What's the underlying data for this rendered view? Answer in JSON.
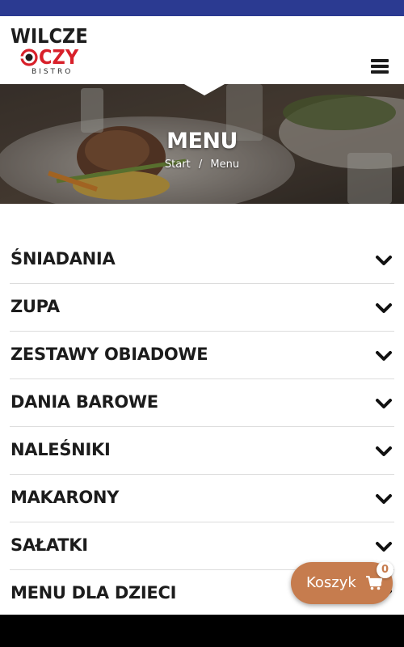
{
  "brand": {
    "line1": "WILCZE",
    "line2": "CZY",
    "tagline": "BISTRO",
    "accent": "#d8202a",
    "topbar_color": "#2b3a91"
  },
  "header": {
    "menu_icon": "hamburger-icon"
  },
  "hero": {
    "title": "MENU",
    "breadcrumb": {
      "home": "Start",
      "separator": "/",
      "current": "Menu"
    }
  },
  "menu": {
    "categories": [
      {
        "label": "ŚNIADANIA",
        "icon": "chevron-down-icon"
      },
      {
        "label": "ZUPA",
        "icon": "chevron-down-icon"
      },
      {
        "label": "ZESTAWY OBIADOWE",
        "icon": "chevron-down-icon"
      },
      {
        "label": "DANIA BAROWE",
        "icon": "chevron-down-icon"
      },
      {
        "label": "NALEŚNIKI",
        "icon": "chevron-down-icon"
      },
      {
        "label": "MAKARONY",
        "icon": "chevron-down-icon"
      },
      {
        "label": "SAŁATKI",
        "icon": "chevron-down-icon"
      },
      {
        "label": "MENU DLA DZIECI",
        "icon": "chevron-down-icon"
      }
    ]
  },
  "cart": {
    "label": "Koszyk",
    "count": "0",
    "icon": "cart-icon",
    "color": "#c67c4e"
  }
}
